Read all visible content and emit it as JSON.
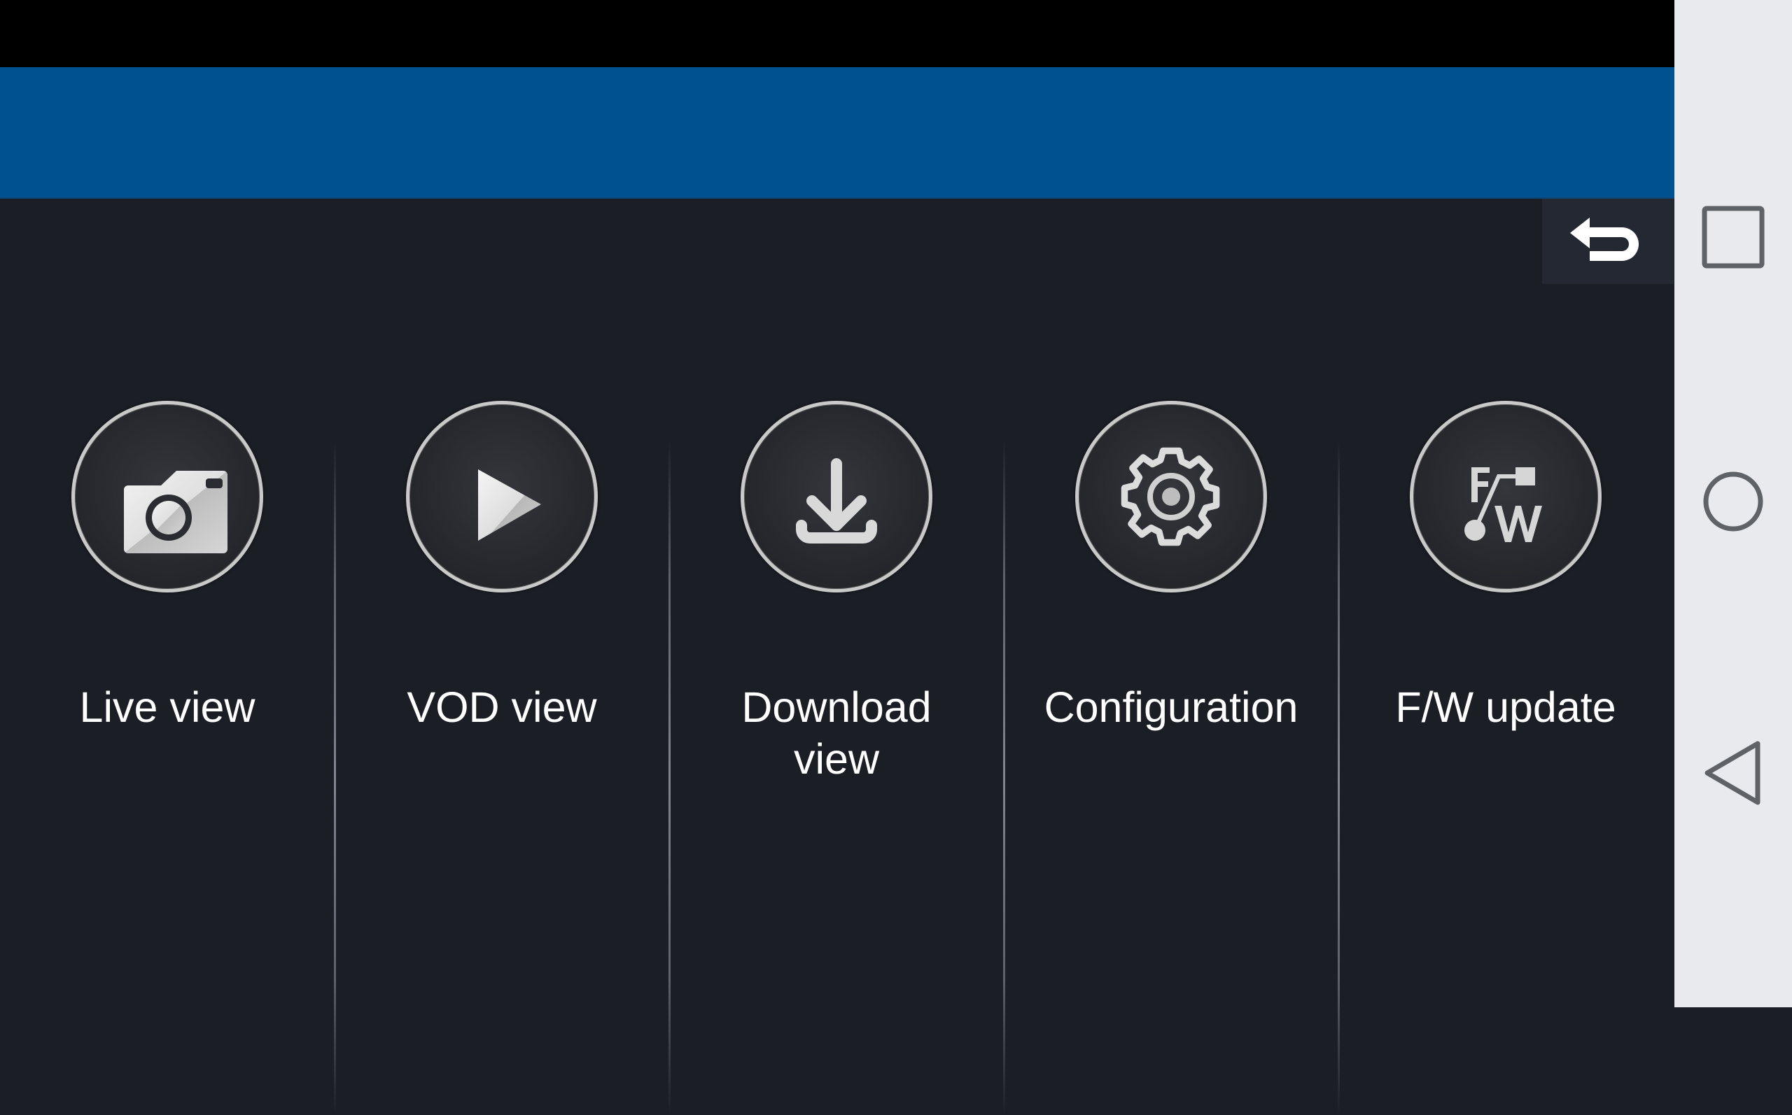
{
  "status_bar": {},
  "header": {
    "title": ""
  },
  "back_button": {
    "icon": "return-arrow-icon",
    "label": "Back"
  },
  "menu": {
    "items": [
      {
        "id": "live-view",
        "label": "Live view",
        "icon": "camera-icon"
      },
      {
        "id": "vod-view",
        "label": "VOD view",
        "icon": "play-icon"
      },
      {
        "id": "download-view",
        "label": "Download view",
        "icon": "download-icon"
      },
      {
        "id": "configuration",
        "label": "Configuration",
        "icon": "gear-icon"
      },
      {
        "id": "fw-update",
        "label": "F/W update",
        "icon": "firmware-icon"
      }
    ]
  },
  "navbar": {
    "recents": {
      "icon": "recents-square-icon",
      "label": "Recent apps"
    },
    "home": {
      "icon": "home-circle-icon",
      "label": "Home"
    },
    "back": {
      "icon": "back-triangle-icon",
      "label": "Back"
    }
  },
  "colors": {
    "header_blue": "#00518f",
    "background": "#1b1e25",
    "navbar_bg": "#e8eaed",
    "navbar_icon": "#5f6368",
    "label_text": "#ffffff"
  }
}
